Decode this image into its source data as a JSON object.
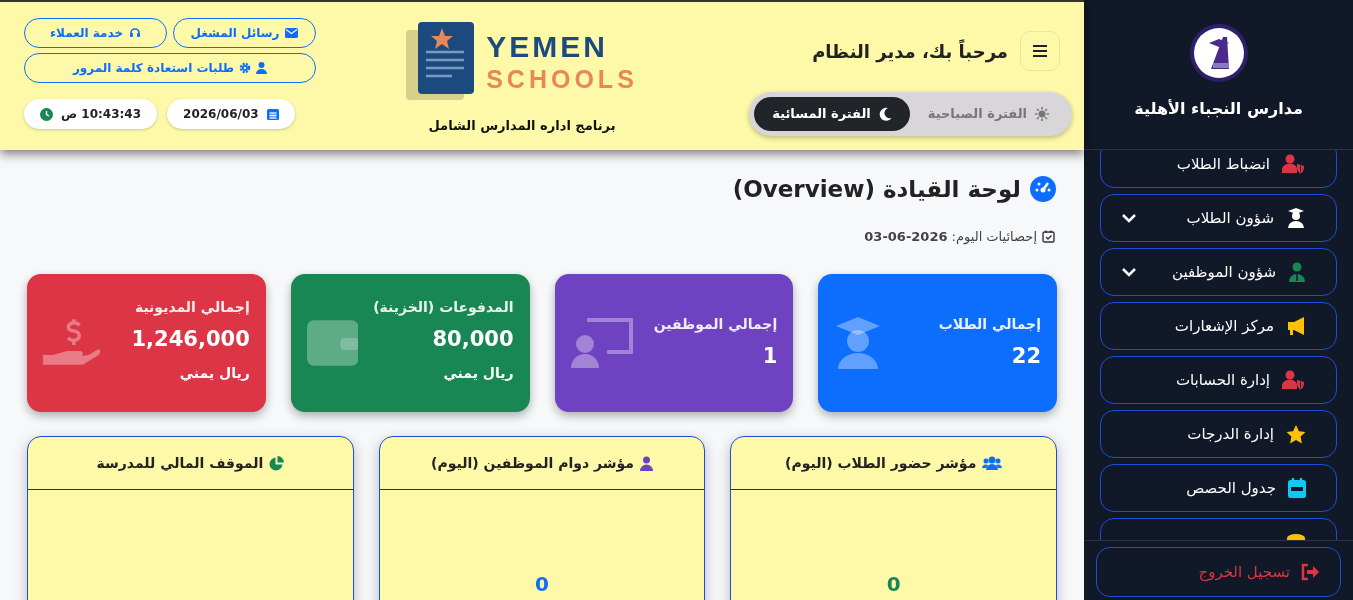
{
  "sidebar": {
    "title": "مدارس النجباء الأهلية",
    "items": [
      {
        "label": "انضباط الطلاب",
        "expandable": false
      },
      {
        "label": "شؤون الطلاب",
        "expandable": true
      },
      {
        "label": "شؤون الموظفين",
        "expandable": true
      },
      {
        "label": "مركز الإشعارات",
        "expandable": false
      },
      {
        "label": "إدارة الحسابات",
        "expandable": false
      },
      {
        "label": "إدارة الدرجات",
        "expandable": false
      },
      {
        "label": "جدول الحصص",
        "expandable": false
      }
    ],
    "logout": "تسجيل الخروج"
  },
  "header": {
    "welcome": "مرحباً بك، مدير النظام",
    "periods": [
      {
        "label": "الفترة الصباحية",
        "selected": false
      },
      {
        "label": "الفترة المسائية",
        "selected": true
      }
    ],
    "logo": {
      "line_1": "YEMEN",
      "line_2": "SCHOOLS",
      "subtitle": "برنامج اداره المدارس الشامل"
    },
    "buttons": [
      "رسائل المشغل",
      "خدمة العملاء",
      "طلبات استعادة كلمة المرور"
    ],
    "date": "2026/06/03",
    "time": "10:43:43 ص"
  },
  "page": {
    "title": "لوحة القيادة (Overview)",
    "stats_date": "إحصائيات اليوم: **03-06-2026**"
  },
  "stat_cards": [
    {
      "title": "إجمالي الطلاب",
      "value": "22",
      "color": "#0d6efd"
    },
    {
      "title": "إجمالي الموظفين",
      "value": "1",
      "color": "#6f42c1"
    },
    {
      "title": "المدفوعات (الخزينة)",
      "value": "80,000",
      "unit": "ريال يمني",
      "color": "#198754"
    },
    {
      "title": "إجمالي المديونية",
      "value": "1,246,000",
      "unit": "ريال يمني",
      "color": "#dc3545"
    }
  ],
  "panels": [
    {
      "title": "مؤشر حضور الطلاب (اليوم)",
      "value": "0",
      "color": "#198754"
    },
    {
      "title": "مؤشر دوام الموظفين (اليوم)",
      "value": "0",
      "color": "#0d6efd"
    },
    {
      "title": "الموقف المالي للمدرسة"
    }
  ]
}
